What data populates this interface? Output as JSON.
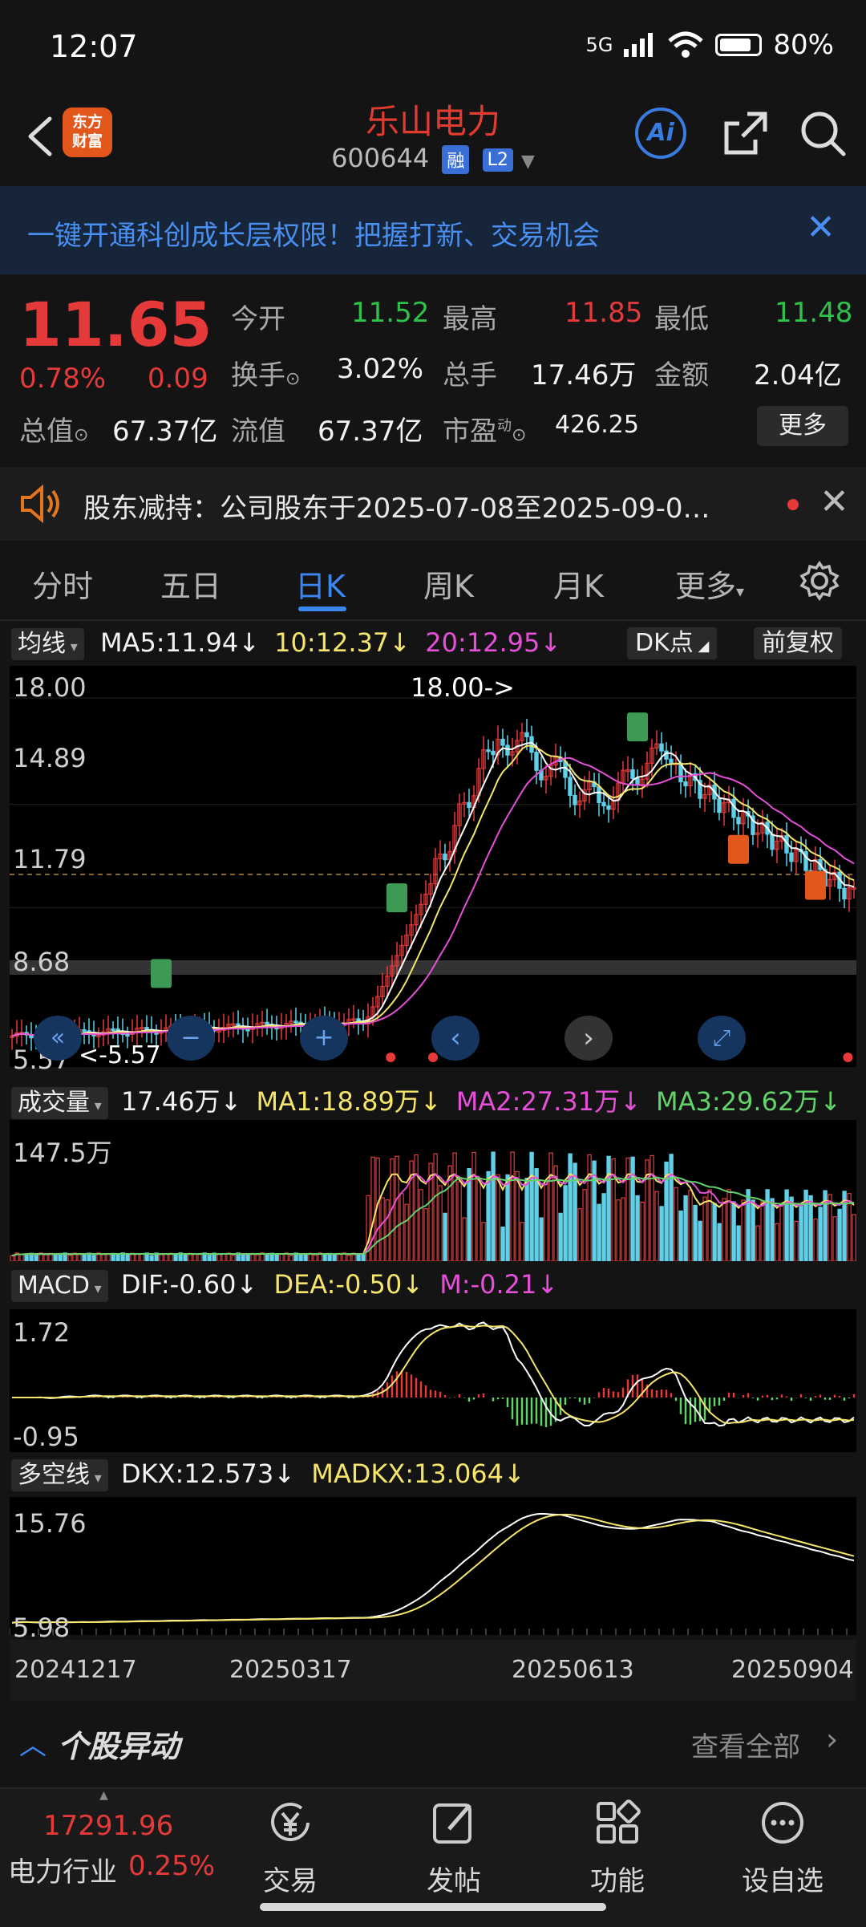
{
  "status_bar": {
    "time": "12:07",
    "network": "5G",
    "battery": "80%"
  },
  "header": {
    "title": "乐山电力",
    "code": "600644",
    "badge_rong": "融",
    "badge_l2": "L2",
    "logo_line1": "东方",
    "logo_line2": "财富",
    "ai_label": "Ai"
  },
  "banner": {
    "text": "一键开通科创成长层权限！把握打新、交易机会"
  },
  "quote": {
    "price": "11.65",
    "pct": "0.78%",
    "change": "0.09",
    "open_label": "今开",
    "open": "11.52",
    "high_label": "最高",
    "high": "11.85",
    "low_label": "最低",
    "low": "11.48",
    "turnover_label": "换手",
    "turnover": "3.02%",
    "volume_label": "总手",
    "volume": "17.46万",
    "amount_label": "金额",
    "amount": "2.04亿",
    "mktcap_label": "总值",
    "mktcap": "67.37亿",
    "float_label": "流值",
    "float": "67.37亿",
    "pe_label": "市盈",
    "pe_sup": "动",
    "pe": "426.25",
    "more": "更多"
  },
  "notice": {
    "text": "股东减持：公司股东于2025-07-08至2025-09-0…"
  },
  "tabs": [
    "分时",
    "五日",
    "日K",
    "周K",
    "月K",
    "更多"
  ],
  "active_tab": 2,
  "kline": {
    "chip": "均线",
    "ma5": "MA5:11.94",
    "ma10": "10:12.37",
    "ma20": "20:12.95",
    "dk": "DK点",
    "adjust": "前复权",
    "y_labels": [
      "18.00",
      "14.89",
      "11.79",
      "8.68",
      "5.57"
    ],
    "max_marker": "18.00->",
    "min_marker": "<-5.57",
    "markers_green": [
      "9",
      "9",
      "9",
      "9"
    ],
    "markers_orange": [
      "9",
      "9",
      "9"
    ]
  },
  "volume": {
    "chip": "成交量",
    "value": "17.46万",
    "ma1": "MA1:18.89万",
    "ma2": "MA2:27.31万",
    "ma3": "MA3:29.62万",
    "y_label": "147.5万"
  },
  "macd": {
    "chip": "MACD",
    "dif": "DIF:-0.60",
    "dea": "DEA:-0.50",
    "m": "M:-0.21",
    "y_top": "1.72",
    "y_bottom": "-0.95"
  },
  "dkx": {
    "chip": "多空线",
    "dkx": "DKX:12.573",
    "madkx": "MADKX:13.064",
    "y_top": "15.76",
    "y_bottom": "5.98"
  },
  "dates": [
    "20241217",
    "20250317",
    "20250613",
    "20250904"
  ],
  "movement": {
    "title": "个股异动",
    "view_all": "查看全部"
  },
  "bottom_nav": {
    "index_value": "17291.96",
    "index_name": "电力行业",
    "index_pct": "0.25%",
    "items": [
      "交易",
      "发帖",
      "功能",
      "设自选"
    ]
  },
  "colors": {
    "up": "#e63a3a",
    "down": "#2fc24a",
    "accent": "#3c86f0",
    "ma5": "#ffffff",
    "ma10": "#f5e66b",
    "ma20": "#e64fd8"
  }
}
